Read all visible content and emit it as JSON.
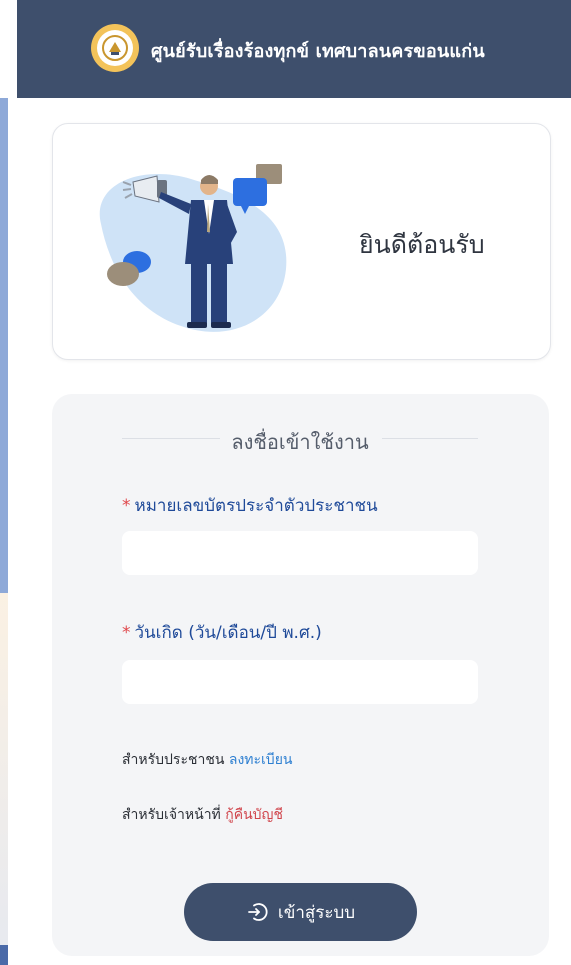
{
  "header": {
    "title": "ศูนย์รับเรื่องร้องทุกข์ เทศบาลนครขอนแก่น",
    "logo_icon": "city-seal-logo"
  },
  "welcome": {
    "text": "ยินดีต้อนรับ",
    "illustration_icon": "businessman-megaphone-illustration"
  },
  "login": {
    "heading": "ลงชื่อเข้าใช้งาน",
    "id_field": {
      "required_mark": "*",
      "label": "หมายเลขบัตรประจำตัวประชาชน",
      "value": ""
    },
    "dob_field": {
      "required_mark": "*",
      "label": "วันเกิด (วัน/เดือน/ปี พ.ศ.)",
      "value": ""
    },
    "citizen_row": {
      "prefix": "สำหรับประชาชน",
      "link": "ลงทะเบียน"
    },
    "staff_row": {
      "prefix": "สำหรับเจ้าหน้าที่",
      "link": "กู้คืนบัญชี"
    },
    "submit_label": "เข้าสู่ระบบ",
    "submit_icon": "login-arrow-icon"
  },
  "colors": {
    "header_bg": "#3e4f6c",
    "label_blue": "#1f4a99",
    "required_red": "#e0464a",
    "link_blue": "#2d7fd1",
    "link_red": "#d0454c"
  }
}
